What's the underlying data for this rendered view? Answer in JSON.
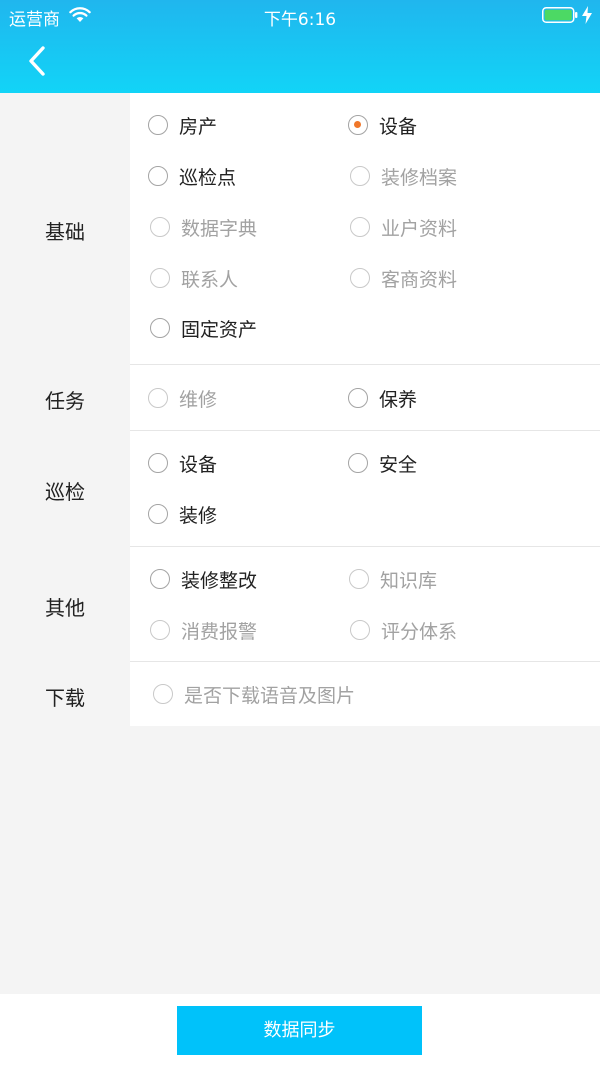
{
  "status_bar": {
    "carrier": "运营商",
    "time": "下午6:16"
  },
  "icons": {
    "back": "back-chevron-icon",
    "wifi": "wifi-icon",
    "battery": "battery-icon",
    "charging": "charging-bolt-icon"
  },
  "colors": {
    "header_top": "#20b6ee",
    "header_bottom": "#12d4f7",
    "accent_selected": "#f0772a",
    "sync_button": "#00c2fa"
  },
  "sections": {
    "basic": {
      "label": "基础",
      "options": [
        {
          "label": "房产",
          "checked": false,
          "enabled": true
        },
        {
          "label": "设备",
          "checked": true,
          "enabled": true
        },
        {
          "label": "巡检点",
          "checked": false,
          "enabled": true
        },
        {
          "label": "装修档案",
          "checked": false,
          "enabled": false
        },
        {
          "label": "数据字典",
          "checked": false,
          "enabled": false
        },
        {
          "label": "业户资料",
          "checked": false,
          "enabled": false
        },
        {
          "label": "联系人",
          "checked": false,
          "enabled": false
        },
        {
          "label": "客商资料",
          "checked": false,
          "enabled": false
        },
        {
          "label": "固定资产",
          "checked": false,
          "enabled": true
        }
      ]
    },
    "task": {
      "label": "任务",
      "options": [
        {
          "label": "维修",
          "checked": false,
          "enabled": false
        },
        {
          "label": "保养",
          "checked": false,
          "enabled": true
        }
      ]
    },
    "patrol": {
      "label": "巡检",
      "options": [
        {
          "label": "设备",
          "checked": false,
          "enabled": true
        },
        {
          "label": "安全",
          "checked": false,
          "enabled": true
        },
        {
          "label": "装修",
          "checked": false,
          "enabled": true
        }
      ]
    },
    "other": {
      "label": "其他",
      "options": [
        {
          "label": "装修整改",
          "checked": false,
          "enabled": true
        },
        {
          "label": "知识库",
          "checked": false,
          "enabled": false
        },
        {
          "label": "消费报警",
          "checked": false,
          "enabled": false
        },
        {
          "label": "评分体系",
          "checked": false,
          "enabled": false
        }
      ]
    },
    "download": {
      "label": "下载",
      "options": [
        {
          "label": "是否下载语音及图片",
          "checked": false,
          "enabled": false
        }
      ]
    }
  },
  "footer": {
    "sync_label": "数据同步"
  }
}
